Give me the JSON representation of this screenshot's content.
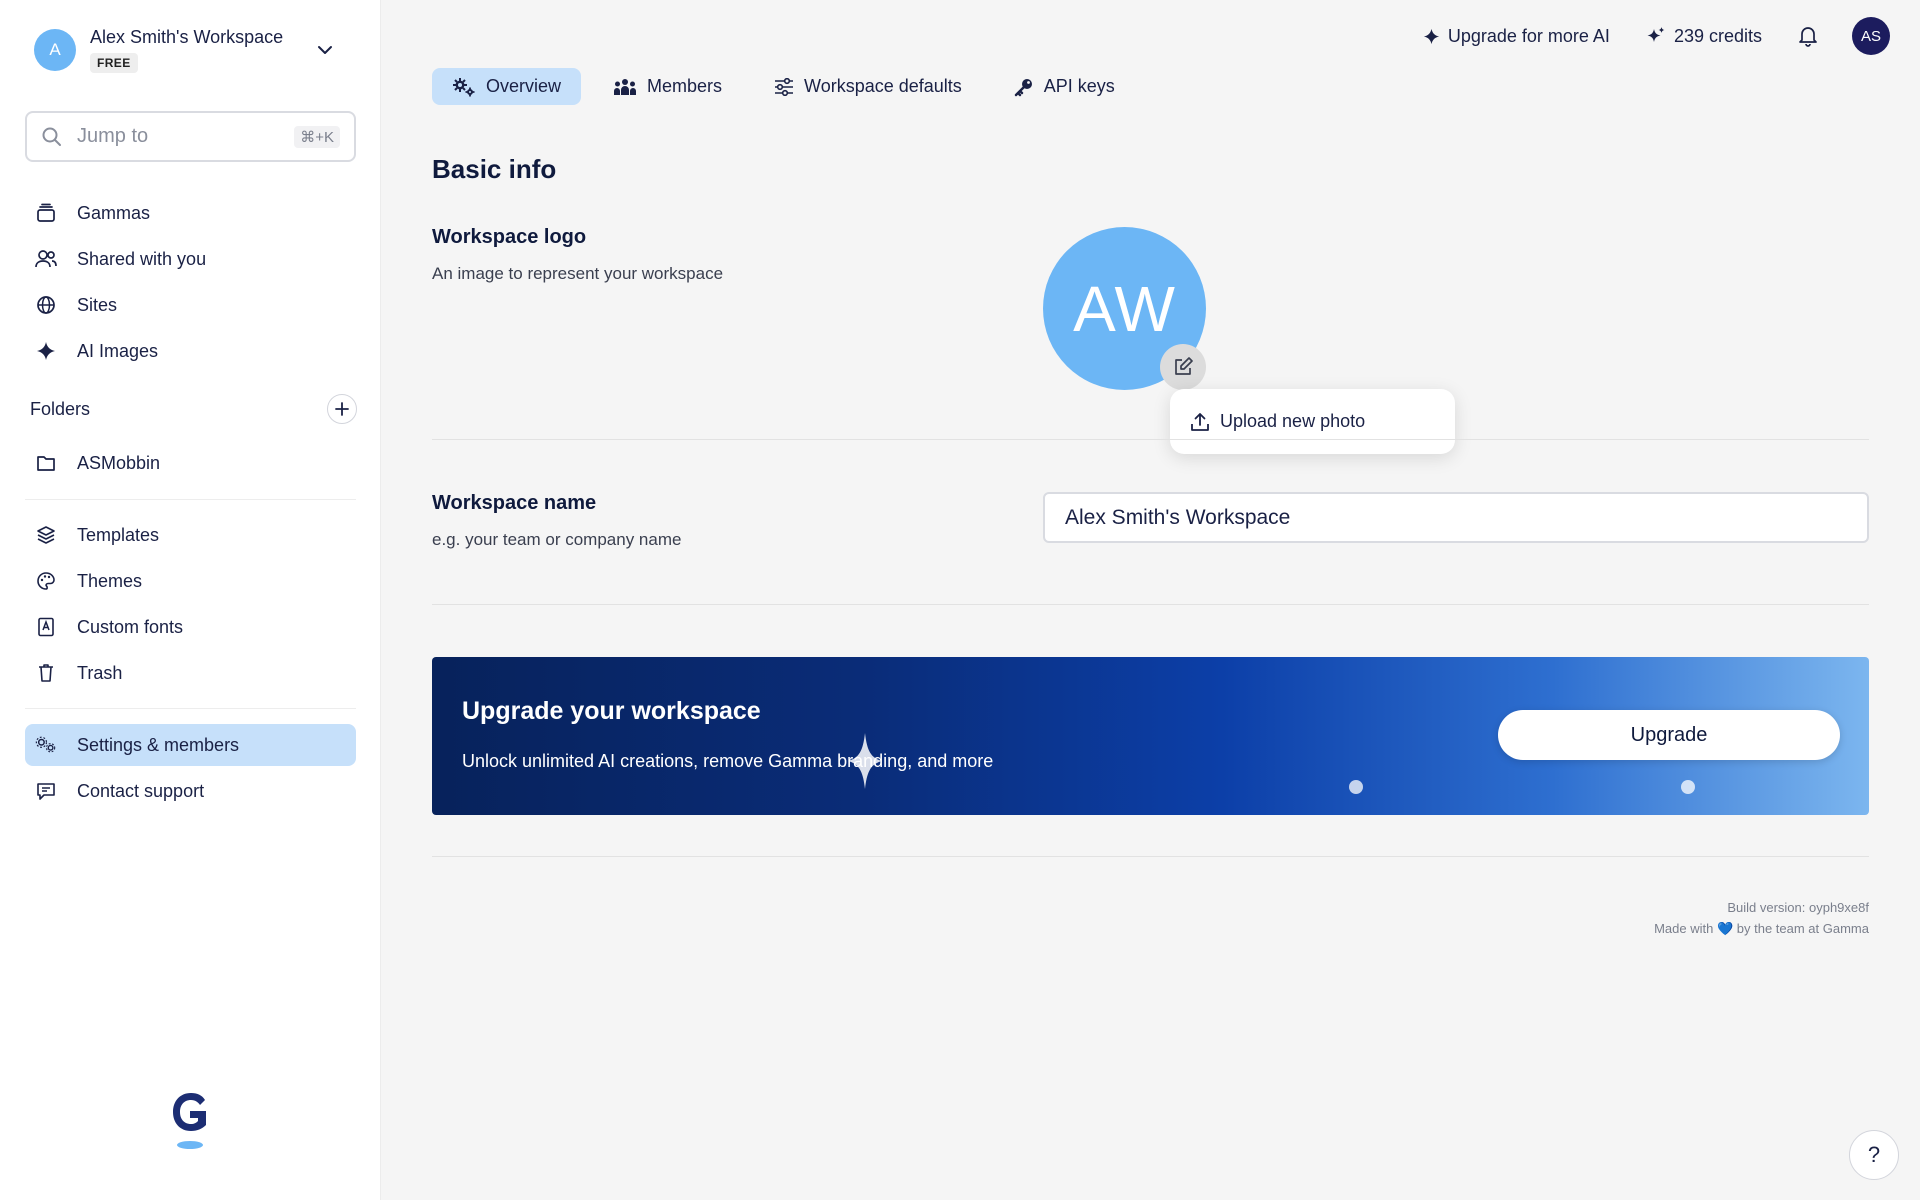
{
  "workspace": {
    "avatar_initial": "A",
    "name": "Alex Smith's Workspace",
    "plan": "FREE"
  },
  "search": {
    "placeholder": "Jump to",
    "shortcut": "⌘+K"
  },
  "nav_primary": [
    {
      "label": "Gammas",
      "icon": "stack-icon"
    },
    {
      "label": "Shared with you",
      "icon": "users-icon"
    },
    {
      "label": "Sites",
      "icon": "globe-icon"
    },
    {
      "label": "AI Images",
      "icon": "sparkle-icon"
    }
  ],
  "folders": {
    "title": "Folders",
    "items": [
      {
        "label": "ASMobbin",
        "icon": "folder-icon"
      }
    ]
  },
  "nav_secondary": [
    {
      "label": "Templates",
      "icon": "layers-icon"
    },
    {
      "label": "Themes",
      "icon": "palette-icon"
    },
    {
      "label": "Custom fonts",
      "icon": "font-book-icon"
    },
    {
      "label": "Trash",
      "icon": "trash-icon"
    }
  ],
  "nav_tertiary": [
    {
      "label": "Settings & members",
      "icon": "settings-members-icon",
      "active": true
    },
    {
      "label": "Contact support",
      "icon": "chat-icon"
    }
  ],
  "topbar": {
    "upgrade_label": "Upgrade for more AI",
    "credits_label": "239 credits",
    "user_initials": "AS"
  },
  "tabs": [
    {
      "label": "Overview",
      "icon": "gears-icon",
      "active": true
    },
    {
      "label": "Members",
      "icon": "team-icon"
    },
    {
      "label": "Workspace defaults",
      "icon": "sliders-icon"
    },
    {
      "label": "API keys",
      "icon": "key-icon"
    }
  ],
  "basic_info": {
    "title": "Basic info",
    "logo_label": "Workspace logo",
    "logo_help": "An image to represent your workspace",
    "logo_initials": "AW",
    "upload_label": "Upload new photo",
    "name_label": "Workspace name",
    "name_help": "e.g. your team or company name",
    "name_value": "Alex Smith's Workspace"
  },
  "banner": {
    "title": "Upgrade your workspace",
    "subtitle": "Unlock unlimited AI creations, remove Gamma branding, and more",
    "button_label": "Upgrade"
  },
  "footer": {
    "build": "Build version: oyph9xe8f",
    "made_with_prefix": "Made with",
    "heart": "💙",
    "made_with_suffix": "by the team at Gamma"
  },
  "help_label": "?",
  "colors": {
    "accent_blue": "#6cb6f5",
    "active_bg": "#c6e0fa",
    "navy": "#0f1a3d",
    "user_avatar": "#1c1c5e"
  }
}
